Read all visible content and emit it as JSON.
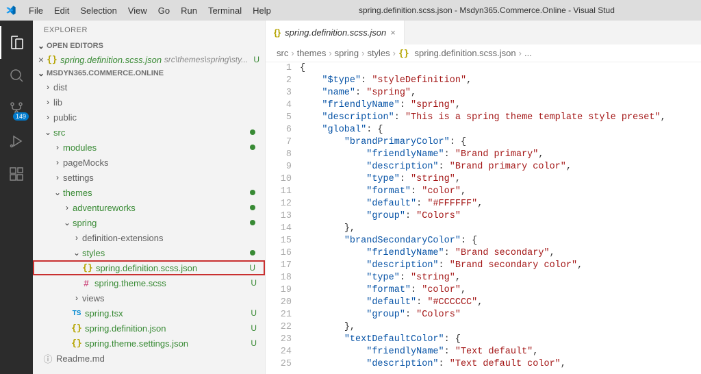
{
  "window": {
    "title": "spring.definition.scss.json - Msdyn365.Commerce.Online - Visual Stud"
  },
  "menu": {
    "items": [
      "File",
      "Edit",
      "Selection",
      "View",
      "Go",
      "Run",
      "Terminal",
      "Help"
    ]
  },
  "activity": {
    "scm_badge": "149"
  },
  "sidebar": {
    "title": "EXPLORER",
    "sections": {
      "open_editors_label": "OPEN EDITORS",
      "workspace_label": "MSDYN365.COMMERCE.ONLINE"
    },
    "open_editor": {
      "name": "spring.definition.scss.json",
      "path": "src\\themes\\spring\\sty...",
      "status": "U"
    },
    "tree": [
      {
        "label": "dist",
        "kind": "folder",
        "depth": 0,
        "expanded": false,
        "color": "dim"
      },
      {
        "label": "lib",
        "kind": "folder",
        "depth": 0,
        "expanded": false,
        "color": "dim"
      },
      {
        "label": "public",
        "kind": "folder",
        "depth": 0,
        "expanded": false,
        "color": "dim"
      },
      {
        "label": "src",
        "kind": "folder",
        "depth": 0,
        "expanded": true,
        "color": "green",
        "dot": true
      },
      {
        "label": "modules",
        "kind": "folder",
        "depth": 1,
        "expanded": false,
        "color": "green",
        "dot": true
      },
      {
        "label": "pageMocks",
        "kind": "folder",
        "depth": 1,
        "expanded": false,
        "color": "dim"
      },
      {
        "label": "settings",
        "kind": "folder",
        "depth": 1,
        "expanded": false,
        "color": "dim"
      },
      {
        "label": "themes",
        "kind": "folder",
        "depth": 1,
        "expanded": true,
        "color": "green",
        "dot": true
      },
      {
        "label": "adventureworks",
        "kind": "folder",
        "depth": 2,
        "expanded": false,
        "color": "green",
        "dot": true
      },
      {
        "label": "spring",
        "kind": "folder",
        "depth": 2,
        "expanded": true,
        "color": "green",
        "dot": true
      },
      {
        "label": "definition-extensions",
        "kind": "folder",
        "depth": 3,
        "expanded": false,
        "color": "dim"
      },
      {
        "label": "styles",
        "kind": "folder",
        "depth": 3,
        "expanded": true,
        "color": "green",
        "dot": true
      },
      {
        "label": "spring.definition.scss.json",
        "kind": "file",
        "ico": "json",
        "depth": 4,
        "color": "green",
        "status": "U",
        "highlight": true
      },
      {
        "label": "spring.theme.scss",
        "kind": "file",
        "ico": "scss",
        "depth": 4,
        "color": "green",
        "status": "U"
      },
      {
        "label": "views",
        "kind": "folder",
        "depth": 3,
        "expanded": false,
        "color": "dim"
      },
      {
        "label": "spring.tsx",
        "kind": "file",
        "ico": "ts",
        "depth": 3,
        "color": "green",
        "status": "U"
      },
      {
        "label": "spring.definition.json",
        "kind": "file",
        "ico": "json",
        "depth": 3,
        "color": "green",
        "status": "U"
      },
      {
        "label": "spring.theme.settings.json",
        "kind": "file",
        "ico": "json",
        "depth": 3,
        "color": "green",
        "status": "U"
      },
      {
        "label": "Readme.md",
        "kind": "file",
        "ico": "info",
        "depth": 0,
        "color": "dim"
      }
    ]
  },
  "editor": {
    "tab": {
      "filename": "spring.definition.scss.json"
    },
    "breadcrumbs": [
      "src",
      "themes",
      "spring",
      "styles",
      "spring.definition.scss.json",
      "..."
    ],
    "lines": [
      {
        "n": 1,
        "tokens": [
          {
            "t": "{",
            "c": "punc"
          }
        ]
      },
      {
        "n": 2,
        "indent": 1,
        "tokens": [
          {
            "t": "\"$type\"",
            "c": "key"
          },
          {
            "t": ": ",
            "c": "punc"
          },
          {
            "t": "\"styleDefinition\"",
            "c": "str"
          },
          {
            "t": ",",
            "c": "punc"
          }
        ]
      },
      {
        "n": 3,
        "indent": 1,
        "tokens": [
          {
            "t": "\"name\"",
            "c": "key"
          },
          {
            "t": ": ",
            "c": "punc"
          },
          {
            "t": "\"spring\"",
            "c": "str"
          },
          {
            "t": ",",
            "c": "punc"
          }
        ]
      },
      {
        "n": 4,
        "indent": 1,
        "tokens": [
          {
            "t": "\"friendlyName\"",
            "c": "key"
          },
          {
            "t": ": ",
            "c": "punc"
          },
          {
            "t": "\"spring\"",
            "c": "str"
          },
          {
            "t": ",",
            "c": "punc"
          }
        ]
      },
      {
        "n": 5,
        "indent": 1,
        "tokens": [
          {
            "t": "\"description\"",
            "c": "key"
          },
          {
            "t": ": ",
            "c": "punc"
          },
          {
            "t": "\"This is a spring theme template style preset\"",
            "c": "str"
          },
          {
            "t": ",",
            "c": "punc"
          }
        ]
      },
      {
        "n": 6,
        "indent": 1,
        "tokens": [
          {
            "t": "\"global\"",
            "c": "key"
          },
          {
            "t": ": {",
            "c": "punc"
          }
        ]
      },
      {
        "n": 7,
        "indent": 2,
        "tokens": [
          {
            "t": "\"brandPrimaryColor\"",
            "c": "key"
          },
          {
            "t": ": {",
            "c": "punc"
          }
        ]
      },
      {
        "n": 8,
        "indent": 3,
        "tokens": [
          {
            "t": "\"friendlyName\"",
            "c": "key"
          },
          {
            "t": ": ",
            "c": "punc"
          },
          {
            "t": "\"Brand primary\"",
            "c": "str"
          },
          {
            "t": ",",
            "c": "punc"
          }
        ]
      },
      {
        "n": 9,
        "indent": 3,
        "tokens": [
          {
            "t": "\"description\"",
            "c": "key"
          },
          {
            "t": ": ",
            "c": "punc"
          },
          {
            "t": "\"Brand primary color\"",
            "c": "str"
          },
          {
            "t": ",",
            "c": "punc"
          }
        ]
      },
      {
        "n": 10,
        "indent": 3,
        "tokens": [
          {
            "t": "\"type\"",
            "c": "key"
          },
          {
            "t": ": ",
            "c": "punc"
          },
          {
            "t": "\"string\"",
            "c": "str"
          },
          {
            "t": ",",
            "c": "punc"
          }
        ]
      },
      {
        "n": 11,
        "indent": 3,
        "tokens": [
          {
            "t": "\"format\"",
            "c": "key"
          },
          {
            "t": ": ",
            "c": "punc"
          },
          {
            "t": "\"color\"",
            "c": "str"
          },
          {
            "t": ",",
            "c": "punc"
          }
        ]
      },
      {
        "n": 12,
        "indent": 3,
        "tokens": [
          {
            "t": "\"default\"",
            "c": "key"
          },
          {
            "t": ": ",
            "c": "punc"
          },
          {
            "t": "\"#FFFFFF\"",
            "c": "str"
          },
          {
            "t": ",",
            "c": "punc"
          }
        ]
      },
      {
        "n": 13,
        "indent": 3,
        "tokens": [
          {
            "t": "\"group\"",
            "c": "key"
          },
          {
            "t": ": ",
            "c": "punc"
          },
          {
            "t": "\"Colors\"",
            "c": "str"
          }
        ]
      },
      {
        "n": 14,
        "indent": 2,
        "tokens": [
          {
            "t": "},",
            "c": "punc"
          }
        ]
      },
      {
        "n": 15,
        "indent": 2,
        "tokens": [
          {
            "t": "\"brandSecondaryColor\"",
            "c": "key"
          },
          {
            "t": ": {",
            "c": "punc"
          }
        ]
      },
      {
        "n": 16,
        "indent": 3,
        "tokens": [
          {
            "t": "\"friendlyName\"",
            "c": "key"
          },
          {
            "t": ": ",
            "c": "punc"
          },
          {
            "t": "\"Brand secondary\"",
            "c": "str"
          },
          {
            "t": ",",
            "c": "punc"
          }
        ]
      },
      {
        "n": 17,
        "indent": 3,
        "tokens": [
          {
            "t": "\"description\"",
            "c": "key"
          },
          {
            "t": ": ",
            "c": "punc"
          },
          {
            "t": "\"Brand secondary color\"",
            "c": "str"
          },
          {
            "t": ",",
            "c": "punc"
          }
        ]
      },
      {
        "n": 18,
        "indent": 3,
        "tokens": [
          {
            "t": "\"type\"",
            "c": "key"
          },
          {
            "t": ": ",
            "c": "punc"
          },
          {
            "t": "\"string\"",
            "c": "str"
          },
          {
            "t": ",",
            "c": "punc"
          }
        ]
      },
      {
        "n": 19,
        "indent": 3,
        "tokens": [
          {
            "t": "\"format\"",
            "c": "key"
          },
          {
            "t": ": ",
            "c": "punc"
          },
          {
            "t": "\"color\"",
            "c": "str"
          },
          {
            "t": ",",
            "c": "punc"
          }
        ]
      },
      {
        "n": 20,
        "indent": 3,
        "tokens": [
          {
            "t": "\"default\"",
            "c": "key"
          },
          {
            "t": ": ",
            "c": "punc"
          },
          {
            "t": "\"#CCCCCC\"",
            "c": "str"
          },
          {
            "t": ",",
            "c": "punc"
          }
        ]
      },
      {
        "n": 21,
        "indent": 3,
        "tokens": [
          {
            "t": "\"group\"",
            "c": "key"
          },
          {
            "t": ": ",
            "c": "punc"
          },
          {
            "t": "\"Colors\"",
            "c": "str"
          }
        ]
      },
      {
        "n": 22,
        "indent": 2,
        "tokens": [
          {
            "t": "},",
            "c": "punc"
          }
        ]
      },
      {
        "n": 23,
        "indent": 2,
        "tokens": [
          {
            "t": "\"textDefaultColor\"",
            "c": "key"
          },
          {
            "t": ": {",
            "c": "punc"
          }
        ]
      },
      {
        "n": 24,
        "indent": 3,
        "tokens": [
          {
            "t": "\"friendlyName\"",
            "c": "key"
          },
          {
            "t": ": ",
            "c": "punc"
          },
          {
            "t": "\"Text default\"",
            "c": "str"
          },
          {
            "t": ",",
            "c": "punc"
          }
        ]
      },
      {
        "n": 25,
        "indent": 3,
        "tokens": [
          {
            "t": "\"description\"",
            "c": "key"
          },
          {
            "t": ": ",
            "c": "punc"
          },
          {
            "t": "\"Text default color\"",
            "c": "str"
          },
          {
            "t": ",",
            "c": "punc"
          }
        ]
      }
    ]
  }
}
